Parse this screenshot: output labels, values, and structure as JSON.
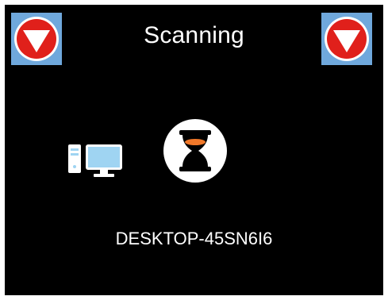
{
  "header": {
    "title": "Scanning"
  },
  "buttons": {
    "left_stop_icon": "stop-icon",
    "right_stop_icon": "stop-icon"
  },
  "status": {
    "computer_icon": "computer-icon",
    "progress_icon": "hourglass-icon",
    "device_name": "DESKTOP-45SN6I6"
  },
  "colors": {
    "background": "#000000",
    "button_bg": "#6fa8dc",
    "stop_red": "#e0201b",
    "hourglass_sand": "#f0782a",
    "computer_blue": "#9fd4f2"
  }
}
